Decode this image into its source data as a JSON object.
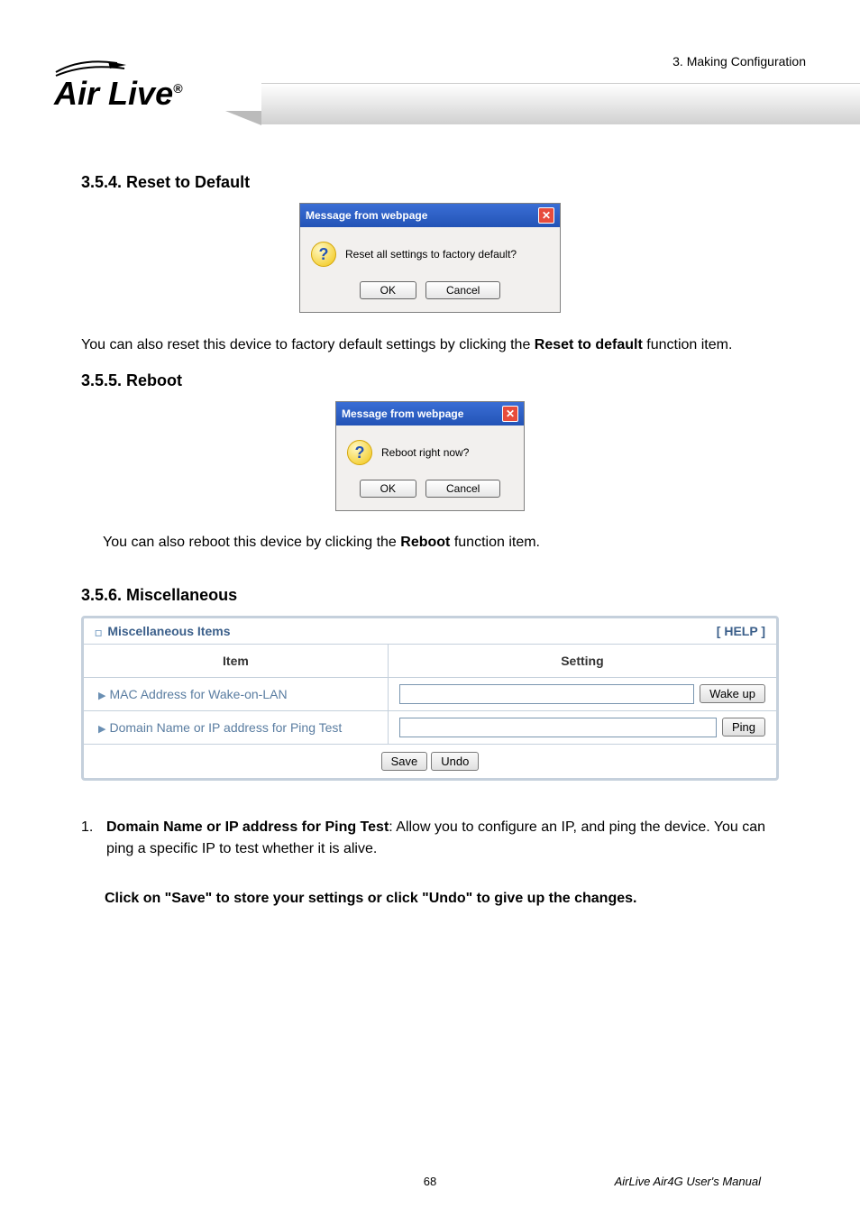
{
  "header": {
    "chapter": "3. Making Configuration",
    "logo_text": "Air Live",
    "logo_reg": "®"
  },
  "sections": {
    "reset": {
      "heading": "3.5.4.  Reset to Default",
      "msg_title": "Message from webpage",
      "msg_body": "Reset all settings to factory default?",
      "ok": "OK",
      "cancel": "Cancel",
      "para_pre": "You can also reset this device to factory default settings by clicking the ",
      "para_bold": "Reset to default",
      "para_post": " function item."
    },
    "reboot": {
      "heading": "3.5.5.  Reboot",
      "msg_title": "Message from webpage",
      "msg_body": "Reboot right now?",
      "ok": "OK",
      "cancel": "Cancel",
      "para_pre": "You can also reboot this device by clicking the ",
      "para_bold": "Reboot",
      "para_post": " function item."
    },
    "misc": {
      "heading": "3.5.6.  Miscellaneous",
      "table": {
        "title": "Miscellaneous Items",
        "help": "[ HELP ]",
        "col_item": "Item",
        "col_setting": "Setting",
        "row1_label": "MAC Address for Wake-on-LAN",
        "row1_btn": "Wake up",
        "row2_label": "Domain Name or IP address for Ping Test",
        "row2_btn": "Ping",
        "save": "Save",
        "undo": "Undo"
      },
      "item1_num": "1.",
      "item1_title": "Domain Name or IP address for Ping Test",
      "item1_text": ": Allow you to configure an IP, and ping the device. You can ping a specific IP to test whether it is alive.",
      "save_note": "Click on \"Save\" to store your settings or click \"Undo\" to give up the changes."
    }
  },
  "footer": {
    "page": "68",
    "manual": "AirLive Air4G User's Manual"
  }
}
